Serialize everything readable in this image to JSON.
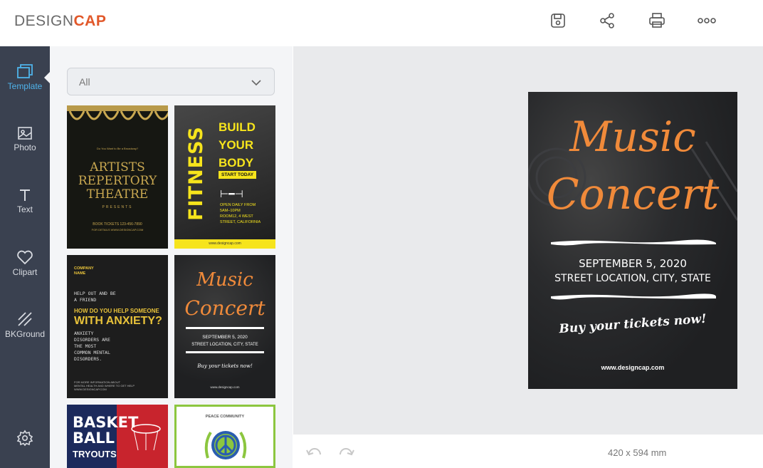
{
  "app": {
    "logo_prefix": "DESIGN",
    "logo_suffix": "CAP"
  },
  "toolbar": {
    "icons": [
      "save-icon",
      "share-icon",
      "print-icon",
      "more-icon"
    ]
  },
  "sidebar": {
    "items": [
      {
        "label": "Template",
        "icon": "template-icon",
        "active": true
      },
      {
        "label": "Photo",
        "icon": "photo-icon"
      },
      {
        "label": "Text",
        "icon": "text-icon"
      },
      {
        "label": "Clipart",
        "icon": "heart-icon"
      },
      {
        "label": "BKGround",
        "icon": "background-icon"
      }
    ],
    "settings_icon": "gear-icon"
  },
  "panel": {
    "filter": {
      "value": "All"
    },
    "templates": [
      {
        "name": "artists-repertory-theatre",
        "small": "Do You Want to Be a Broadway?",
        "title": [
          "ARTISTS",
          "REPERTORY",
          "THEATRE"
        ],
        "sub": "PRESENTS",
        "footer1": "BOOK TICKETS 123-456-7890",
        "footer2": "FOR DETAILS WWW.DESIGNCAP.COM"
      },
      {
        "name": "fitness-build-your-body",
        "side": "FITNESS",
        "title": [
          "BUILD",
          "YOUR",
          "BODY"
        ],
        "badge": "START TODAY",
        "info": [
          "OPEN DAILY FROM",
          "5AM–10PM",
          "ROOM12, 4 WEST",
          "STREET, CALIFORNIA"
        ],
        "footer": "www.designcap.com"
      },
      {
        "name": "anxiety",
        "company": [
          "COMPANY",
          "NAME"
        ],
        "intro": [
          "HELP OUT AND BE",
          "A FRIEND"
        ],
        "question": "HOW DO YOU HELP SOMEONE",
        "big": "WITH ANXIETY?",
        "body": [
          "ANXIETY",
          "DISORDERS ARE",
          "THE MOST",
          "COMMON MENTAL",
          "DISORDERS."
        ],
        "footer1": "FOR MORE INFORMATION ABOUT",
        "footer2": "MENTAL HEALTH AND WHERE TO GET HELP",
        "footer3": "WWW.DESIGNCAP.COM"
      },
      {
        "name": "music-concert-small",
        "title1": "Music",
        "title2": "Concert",
        "date": "SEPTEMBER 5, 2020",
        "loc": "STREET LOCATION, CITY, STATE",
        "cta": "Buy your tickets now!",
        "footer": "www.designcap.com"
      },
      {
        "name": "basketball-tryouts",
        "title": [
          "BASKET",
          "BALL"
        ],
        "sub": "TRYOUTS"
      },
      {
        "name": "peace-community",
        "title": "PEACE COMMUNITY"
      }
    ]
  },
  "poster": {
    "title1": "Music",
    "title2": "Concert",
    "date": "SEPTEMBER 5, 2020",
    "location": "STREET LOCATION, CITY, STATE",
    "cta": "Buy your tickets now!",
    "website": "www.designcap.com"
  },
  "canvas": {
    "size": "420 x 594 mm"
  },
  "colors": {
    "accent": "#e1582a",
    "orange": "#f08a3a",
    "sidebar": "#3a4150",
    "active": "#4fb3ea",
    "fitness_yellow": "#f6e41c"
  }
}
